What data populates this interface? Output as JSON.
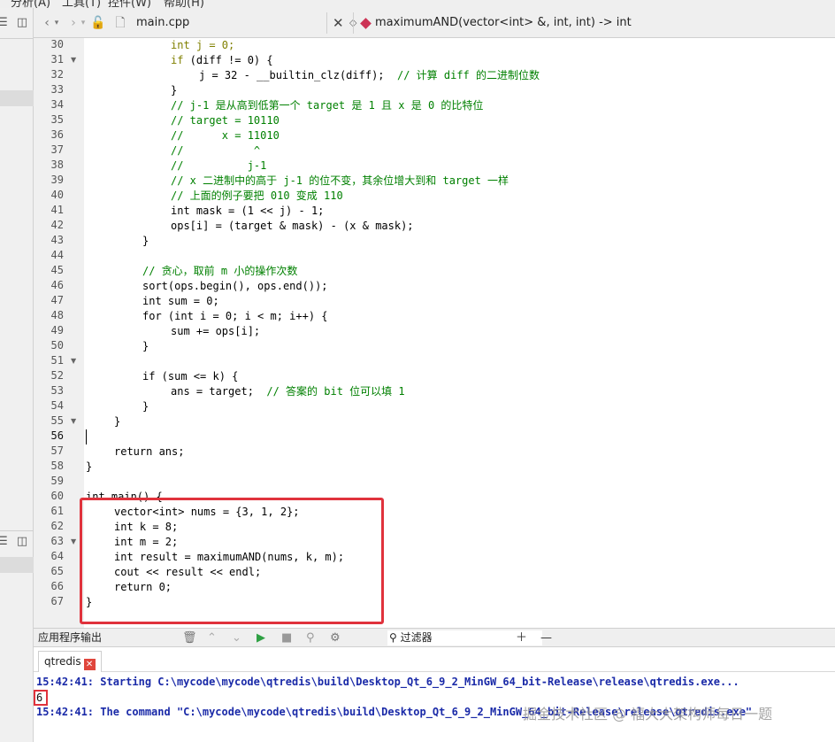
{
  "menu": [
    "分析(A)",
    "工具(T)",
    "控件(W)",
    "帮助(H)"
  ],
  "editor": {
    "file_name": "main.cpp",
    "symbol": "maximumAND(vector<int> &, int, int) -> int"
  },
  "gutter": {
    "lines": [
      "30",
      "31",
      "32",
      "33",
      "34",
      "35",
      "36",
      "37",
      "38",
      "39",
      "40",
      "41",
      "42",
      "43",
      "44",
      "45",
      "46",
      "47",
      "48",
      "49",
      "50",
      "51",
      "52",
      "53",
      "54",
      "55",
      "56",
      "57",
      "58",
      "59",
      "60",
      "61",
      "62",
      "63",
      "64",
      "65",
      "66",
      "67"
    ]
  },
  "code": {
    "l30": "int j = 0;",
    "l31a": "if",
    "l31b": " (diff != 0) {",
    "l32": "j = 32 - __builtin_clz(diff);",
    "l32c": "// 计算 diff 的二进制位数",
    "l33": "}",
    "l34": "// j-1 是从高到低第一个 target 是 1 且 x 是 0 的比特位",
    "l35": "// target = 10110",
    "l36": "//      x = 11010",
    "l37": "//           ^",
    "l38": "//          j-1",
    "l39": "// x 二进制中的高于 j-1 的位不变，其余位增大到和 target 一样",
    "l40": "// 上面的例子要把 010 变成 110",
    "l41": "int mask = (1 << j) - 1;",
    "l42": "ops[i] = (target & mask) - (x & mask);",
    "l43": "}",
    "l45": "// 贪心，取前 m 小的操作次数",
    "l46": "sort(ops.begin(), ops.end());",
    "l47": "int sum = 0;",
    "l48": "for (int i = 0; i < m; i++) {",
    "l49": "sum += ops[i];",
    "l50": "}",
    "l52": "if (sum <= k) {",
    "l53": "ans = target;",
    "l53c": "// 答案的 bit 位可以填 1",
    "l54": "}",
    "l55": "}",
    "l57": "return ans;",
    "l58": "}",
    "l60": "int main() {",
    "l61": "vector<int> nums = {3, 1, 2};",
    "l62": "int k = 8;",
    "l63": "int m = 2;",
    "l64": "int result = maximumAND(nums, k, m);",
    "l65": "cout << result << endl;",
    "l66": "return 0;",
    "l67": "}"
  },
  "output": {
    "panel_title": "应用程序输出",
    "filter_placeholder": "过滤器",
    "tab_label": "qtredis",
    "line1": "15:42:41: Starting C:\\mycode\\mycode\\qtredis\\build\\Desktop_Qt_6_9_2_MinGW_64_bit-Release\\release\\qtredis.exe...",
    "line2": "6",
    "line3": "15:42:41: The command \"C:\\mycode\\mycode\\qtredis\\build\\Desktop_Qt_6_9_2_MinGW_64_bit-Release\\release\\qtredis.exe\""
  },
  "watermark": "掘金技术社区 @ 福大大架构师每日一题"
}
